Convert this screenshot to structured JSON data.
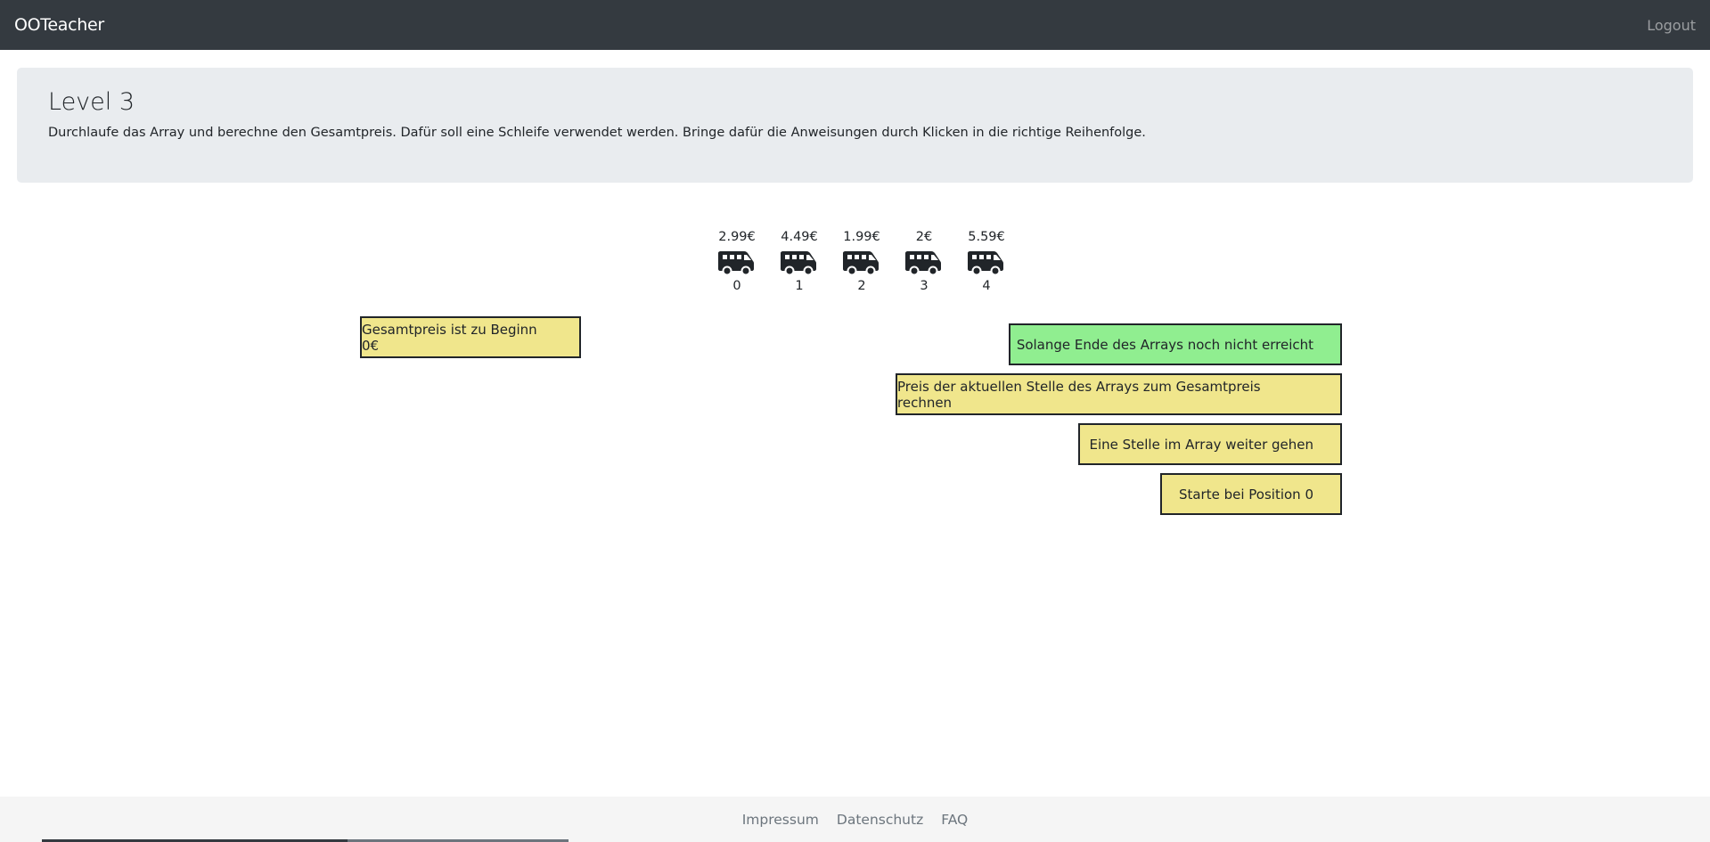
{
  "nav": {
    "brand": "OOTeacher",
    "logout": "Logout"
  },
  "header": {
    "title": "Level 3",
    "description": "Durchlaufe das Array und berechne den Gesamtpreis. Dafür soll eine Schleife verwendet werden. Bringe dafür die Anweisungen durch Klicken in die richtige Reihenfolge."
  },
  "array": {
    "icon": "van-icon",
    "items": [
      {
        "price": "2.99€",
        "index": "0"
      },
      {
        "price": "4.49€",
        "index": "1"
      },
      {
        "price": "1.99€",
        "index": "2"
      },
      {
        "price": "2€",
        "index": "3"
      },
      {
        "price": "5.59€",
        "index": "4"
      }
    ]
  },
  "placed_blocks": [
    {
      "label": "Gesamtpreis ist zu Beginn 0€",
      "color": "#f0e68c"
    }
  ],
  "available_blocks": [
    {
      "label": "Solange Ende des Arrays noch nicht erreicht",
      "color": "#90ee90"
    },
    {
      "label": "Preis der aktuellen Stelle des Arrays zum Gesamtpreis rechnen",
      "color": "#f0e68c"
    },
    {
      "label": "Eine Stelle im Array weiter gehen",
      "color": "#f0e68c"
    },
    {
      "label": "Starte bei Position 0",
      "color": "#f0e68c"
    }
  ],
  "footer": {
    "links": [
      "Impressum",
      "Datenschutz",
      "FAQ"
    ]
  }
}
